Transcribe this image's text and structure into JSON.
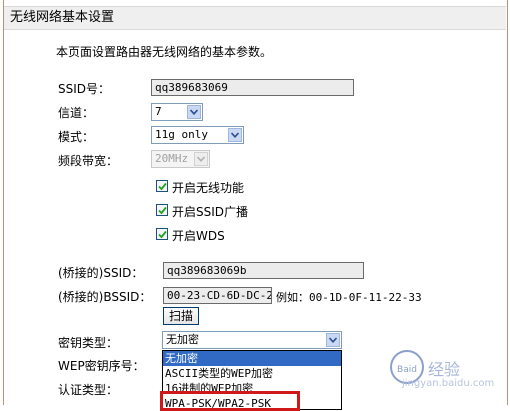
{
  "header": {
    "title": "无线网络基本设置"
  },
  "intro": "本页面设置路由器无线网络的基本参数。",
  "ssid": {
    "label": "SSID号：",
    "value": "qq389683069"
  },
  "channel": {
    "label": "信道：",
    "value": "7"
  },
  "mode": {
    "label": "模式：",
    "value": "11g only"
  },
  "bandwidth": {
    "label": "频段带宽：",
    "value": "20MHz"
  },
  "checkboxes": [
    {
      "label": "开启无线功能",
      "checked": true
    },
    {
      "label": "开启SSID广播",
      "checked": true
    },
    {
      "label": "开启WDS",
      "checked": true
    }
  ],
  "bridge_ssid": {
    "label": "(桥接的)SSID：",
    "value": "qq389683069b"
  },
  "bridge_bssid": {
    "label": "(桥接的)BSSID：",
    "value": "00-23-CD-6D-DC-26",
    "example": "例如：00-1D-0F-11-22-33"
  },
  "scan_button": "扫描",
  "key_type": {
    "label": "密钥类型：",
    "value": "无加密",
    "options": [
      "无加密",
      "ASCII类型的WEP加密",
      "16进制的WEP加密",
      "WPA-PSK/WPA2-PSK"
    ],
    "highlighted_index": 0
  },
  "wep_index_label": "WEP密钥序号：",
  "auth_type_label": "认证类型：",
  "watermark": {
    "symbol": "Baid",
    "text": "经验",
    "url": "jingyan.baidu.com"
  },
  "colors": {
    "highlight": "#316ac5",
    "annotation": "#d01818"
  }
}
